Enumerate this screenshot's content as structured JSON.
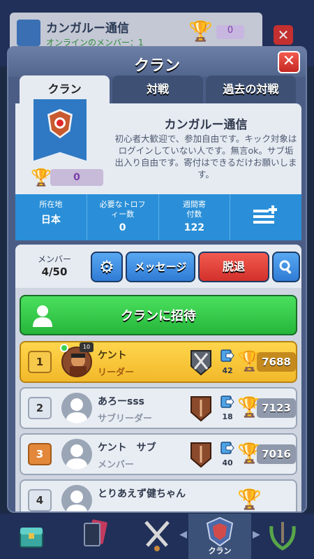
{
  "background": {
    "clan_name": "カンガルー通信",
    "online_text": "オンラインのメンバー：1",
    "trophy_value": "0"
  },
  "modal": {
    "title": "クラン",
    "close_label": "✕",
    "tabs": [
      {
        "label": "クラン",
        "active": true
      },
      {
        "label": "対戦",
        "active": false
      },
      {
        "label": "過去の対戦",
        "active": false
      }
    ]
  },
  "clan": {
    "name": "カンガルー通信",
    "description": "初心者大歓迎で、参加自由です。キック対象はログインしていない人です。無言ok。サブ垢出入り自由です。寄付はできるだけお願いします。",
    "war_trophies": "0"
  },
  "stats": [
    {
      "label": "所在地",
      "value": "日本"
    },
    {
      "label": "必要なトロフィー数",
      "value": "0"
    },
    {
      "label": "週間寄付数",
      "value": "122"
    }
  ],
  "actions": {
    "members_label": "メンバー",
    "members_value": "4/50",
    "message_label": "メッセージ",
    "leave_label": "脱退"
  },
  "invite": {
    "label": "クランに招待"
  },
  "members": [
    {
      "rank": "1",
      "name": "ケント",
      "role": "リーダー",
      "donations": "42",
      "trophies": "7688",
      "level": "10"
    },
    {
      "rank": "2",
      "name": "あろーsss",
      "role": "サブリーダー",
      "donations": "18",
      "trophies": "7123"
    },
    {
      "rank": "3",
      "name": "ケント　サブ",
      "role": "メンバー",
      "donations": "40",
      "trophies": "7016"
    },
    {
      "rank": "4",
      "name": "とりあえず健ちゃん",
      "role": "",
      "donations": "",
      "trophies": ""
    }
  ],
  "nav": {
    "active_label": "クラン"
  },
  "colors": {
    "accent_blue": "#2a8fd8",
    "leave_red": "#d2302b",
    "invite_green": "#26b63a",
    "leader_gold": "#f2b92a"
  }
}
